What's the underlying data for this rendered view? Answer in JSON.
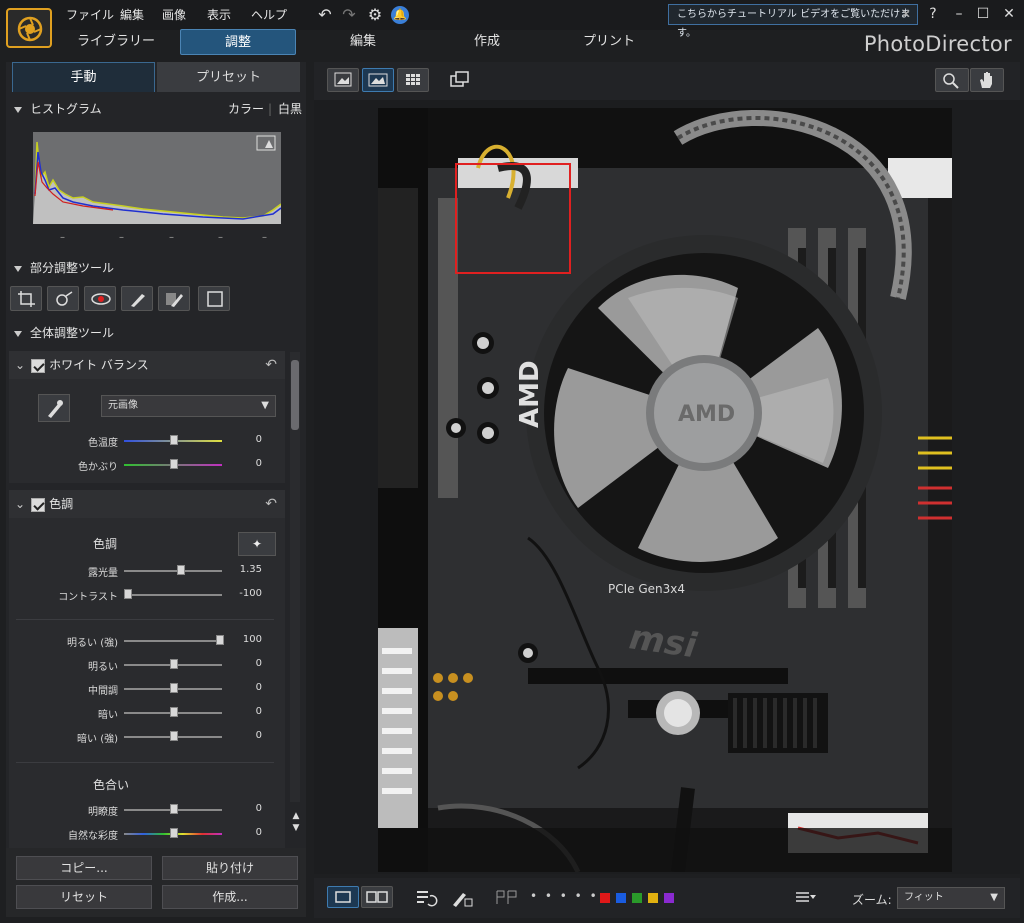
{
  "app": {
    "brand": "PhotoDirector"
  },
  "menu": [
    "ファイル",
    "編集",
    "画像",
    "表示",
    "ヘルプ"
  ],
  "notice": {
    "text": "こちらからチュートリアル ビデオをご覧いただけます。",
    "close": "✕"
  },
  "window": {
    "help": "?"
  },
  "modules": [
    "ライブラリー",
    "調整",
    "編集",
    "作成",
    "プリント"
  ],
  "subtabs": {
    "manual": "手動",
    "preset": "プリセット"
  },
  "histogram": {
    "title": "ヒストグラム",
    "color": "カラー",
    "mono": "白黒",
    "ticks": [
      "–",
      "–",
      "–",
      "–",
      "–"
    ]
  },
  "local_tools": {
    "title": "部分調整ツール"
  },
  "global_tools": {
    "title": "全体調整ツール"
  },
  "white_balance": {
    "title": "ホワイト バランス",
    "preset": "元画像",
    "sliders": [
      {
        "label": "色温度",
        "value": "0",
        "level": 0.5
      },
      {
        "label": "色かぶり",
        "value": "0",
        "level": 0.5
      }
    ]
  },
  "tone": {
    "title": "色調",
    "subtitle": "色調",
    "sliders": [
      {
        "label": "露光量",
        "value": "1.35",
        "level": 0.58
      },
      {
        "label": "コントラスト",
        "value": "-100",
        "level": 0.0
      }
    ],
    "sliders2": [
      {
        "label": "明るい (強)",
        "value": "100",
        "level": 1.0
      },
      {
        "label": "明るい",
        "value": "0",
        "level": 0.5
      },
      {
        "label": "中間調",
        "value": "0",
        "level": 0.5
      },
      {
        "label": "暗い",
        "value": "0",
        "level": 0.5
      },
      {
        "label": "暗い (強)",
        "value": "0",
        "level": 0.5
      }
    ],
    "hue_title": "色合い",
    "sliders3": [
      {
        "label": "明瞭度",
        "value": "0",
        "level": 0.5
      },
      {
        "label": "自然な彩度",
        "value": "0",
        "level": 0.5
      }
    ]
  },
  "bottom_buttons": {
    "copy": "コピー...",
    "paste": "貼り付け",
    "reset": "リセット",
    "create": "作成..."
  },
  "zoom": {
    "label": "ズーム:",
    "value": "フィット"
  },
  "colors": {
    "accent": "#24557c",
    "labels": [
      "#e01818",
      "#1a5ce0",
      "#2a9a2a",
      "#e0b010",
      "#8a2ad0"
    ]
  },
  "photo": {
    "chip_text": "AMD",
    "label_text": "msi",
    "pcie": "PCIe Gen3x4"
  }
}
